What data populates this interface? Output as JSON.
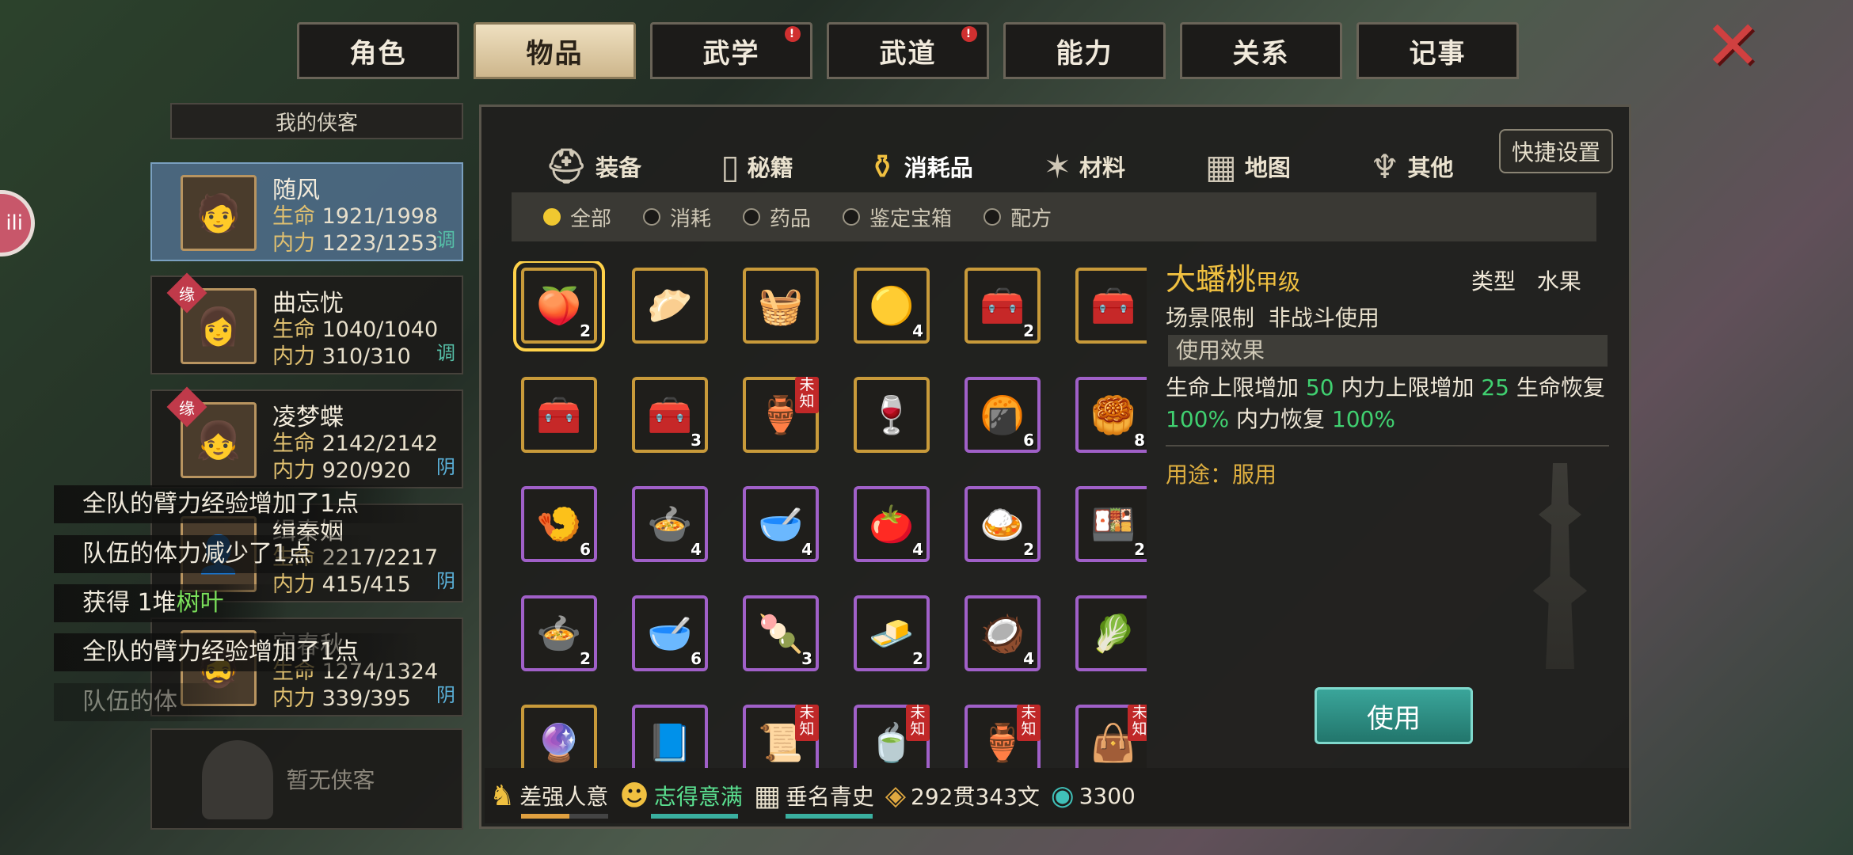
{
  "top_tabs": [
    {
      "label": "角色",
      "alert": false
    },
    {
      "label": "物品",
      "alert": false,
      "active": true
    },
    {
      "label": "武学",
      "alert": true
    },
    {
      "label": "武道",
      "alert": true
    },
    {
      "label": "能力",
      "alert": false
    },
    {
      "label": "关系",
      "alert": false
    },
    {
      "label": "记事",
      "alert": false
    }
  ],
  "left": {
    "header": "我的侠客",
    "empty_slot": "暂无侠客",
    "heroes": [
      {
        "name": "随风",
        "life_label": "生命",
        "life": "1921/1998",
        "mp_label": "内力",
        "mp": "1223/1253",
        "tag": "调",
        "yuan": false,
        "icon": "🧑"
      },
      {
        "name": "曲忘忧",
        "life_label": "生命",
        "life": "1040/1040",
        "mp_label": "内力",
        "mp": "310/310",
        "tag": "调",
        "yuan": true,
        "icon": "👩"
      },
      {
        "name": "凌梦蝶",
        "life_label": "生命",
        "life": "2142/2142",
        "mp_label": "内力",
        "mp": "920/920",
        "tag": "阴",
        "yuan": true,
        "icon": "👧"
      },
      {
        "name": "缉秦姻",
        "life_label": "生命",
        "life": "2217/2217",
        "mp_label": "内力",
        "mp": "415/415",
        "tag": "阴",
        "yuan": false,
        "icon": "👤"
      },
      {
        "name": "宿春秋",
        "life_label": "生命",
        "life": "1274/1324",
        "mp_label": "内力",
        "mp": "339/395",
        "tag": "阴",
        "yuan": false,
        "icon": "🧔"
      }
    ],
    "yuan_label": "缘"
  },
  "notifications": [
    {
      "text": "全队的臂力经验增加了1点"
    },
    {
      "text": "队伍的体力减少了1点"
    },
    {
      "prefix": "获得 1堆",
      "highlight": "树叶"
    },
    {
      "text": "全队的臂力经验增加了1点"
    },
    {
      "text": "队伍的体"
    }
  ],
  "sub_tabs": [
    {
      "label": "装备",
      "icon": "helmet-icon",
      "glyph": "⛑"
    },
    {
      "label": "秘籍",
      "icon": "book-icon",
      "glyph": "▯"
    },
    {
      "label": "消耗品",
      "icon": "potion-icon",
      "glyph": "⚱",
      "active": true
    },
    {
      "label": "材料",
      "icon": "herb-icon",
      "glyph": "✶"
    },
    {
      "label": "地图",
      "icon": "map-icon",
      "glyph": "▦"
    },
    {
      "label": "其他",
      "icon": "misc-icon",
      "glyph": "♆"
    }
  ],
  "quick_settings": "快捷设置",
  "filters": [
    {
      "label": "全部",
      "on": true
    },
    {
      "label": "消耗",
      "on": false
    },
    {
      "label": "药品",
      "on": false
    },
    {
      "label": "鉴定宝箱",
      "on": false
    },
    {
      "label": "配方",
      "on": false
    }
  ],
  "items": [
    {
      "glyph": "🍑",
      "count": "2",
      "color": "gold",
      "sel": true
    },
    {
      "glyph": "🥟",
      "count": "",
      "color": "gold"
    },
    {
      "glyph": "🧺",
      "count": "",
      "color": "gold"
    },
    {
      "glyph": "🟡",
      "count": "4",
      "color": "gold"
    },
    {
      "glyph": "🧰",
      "count": "2",
      "color": "gold"
    },
    {
      "glyph": "🧰",
      "count": "",
      "color": "gold"
    },
    {
      "glyph": "🧰",
      "count": "",
      "color": "gold"
    },
    {
      "glyph": "🧰",
      "count": "3",
      "color": "gold"
    },
    {
      "glyph": "🏺",
      "count": "",
      "color": "gold",
      "unknown": true
    },
    {
      "glyph": "🍷",
      "count": "",
      "color": "gold"
    },
    {
      "glyph": "🍘",
      "count": "6",
      "color": "purple"
    },
    {
      "glyph": "🥮",
      "count": "8",
      "color": "purple"
    },
    {
      "glyph": "🍤",
      "count": "6",
      "color": "purple"
    },
    {
      "glyph": "🍲",
      "count": "4",
      "color": "purple"
    },
    {
      "glyph": "🥣",
      "count": "4",
      "color": "purple"
    },
    {
      "glyph": "🍅",
      "count": "4",
      "color": "purple"
    },
    {
      "glyph": "🍛",
      "count": "2",
      "color": "purple"
    },
    {
      "glyph": "🍱",
      "count": "2",
      "color": "purple"
    },
    {
      "glyph": "🍲",
      "count": "2",
      "color": "purple"
    },
    {
      "glyph": "🥣",
      "count": "6",
      "color": "purple"
    },
    {
      "glyph": "🍡",
      "count": "3",
      "color": "purple"
    },
    {
      "glyph": "🧈",
      "count": "2",
      "color": "purple"
    },
    {
      "glyph": "🥥",
      "count": "4",
      "color": "purple"
    },
    {
      "glyph": "🥬",
      "count": "",
      "color": "purple"
    },
    {
      "glyph": "🔮",
      "count": "",
      "color": "gold"
    },
    {
      "glyph": "📘",
      "count": "",
      "color": "purple"
    },
    {
      "glyph": "📜",
      "count": "",
      "color": "purple",
      "unknown": true
    },
    {
      "glyph": "🍵",
      "count": "",
      "color": "purple",
      "unknown": true
    },
    {
      "glyph": "🏺",
      "count": "",
      "color": "purple",
      "unknown": true
    },
    {
      "glyph": "👜",
      "count": "",
      "color": "purple",
      "unknown": true
    }
  ],
  "unknown_label": "未知",
  "detail": {
    "name": "大蟠桃",
    "grade": "甲级",
    "type_label": "类型",
    "type": "水果",
    "limit_label": "场景限制",
    "limit": "非战斗使用",
    "effect_header": "使用效果",
    "effect": {
      "a": "生命上限增加 ",
      "a_val": "50",
      "b": " 内力上限增加 ",
      "b_val": "25",
      "c": " 生命恢复 ",
      "c_val": "100%",
      "d": " 内力恢复 ",
      "d_val": "100%"
    },
    "usage": "用途：服用",
    "use_button": "使用"
  },
  "status": {
    "mood1": "差强人意",
    "mood2": "志得意满",
    "fame": "垂名青史",
    "money": "292贯343文",
    "jade": "3300"
  }
}
